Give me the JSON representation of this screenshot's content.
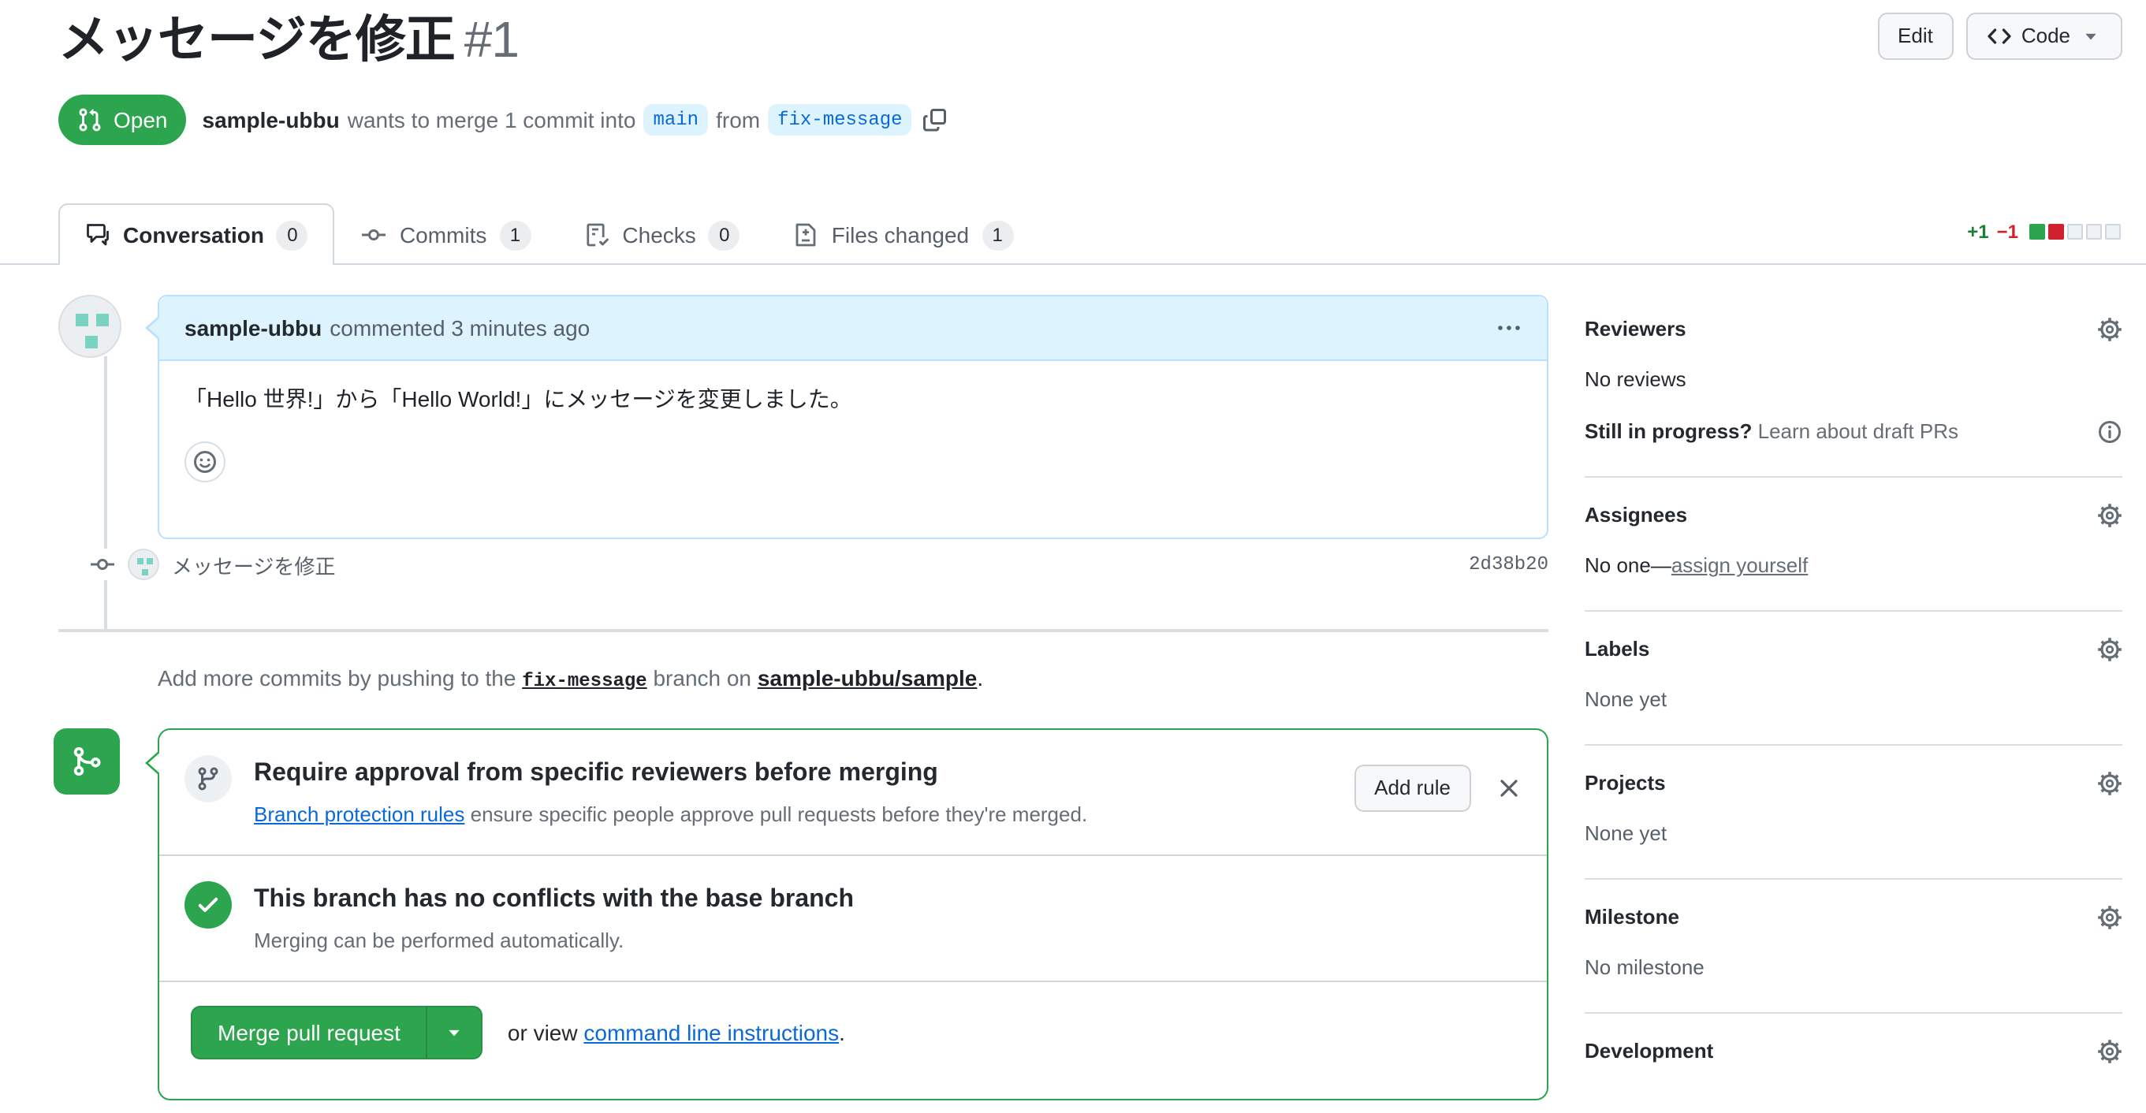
{
  "colors": {
    "open_green": "#2da44e",
    "link_blue": "#0969da",
    "added_green": "#1a7f37",
    "deleted_red": "#cf222e",
    "branch_label_bg": "#ddf4ff"
  },
  "header": {
    "title": "メッセージを修正",
    "number": "#1",
    "actions": {
      "edit": "Edit",
      "code": "Code"
    },
    "state": "Open",
    "meta": {
      "author": "sample-ubbu",
      "action": "wants to merge 1 commit into",
      "base_branch": "main",
      "from_word": "from",
      "head_branch": "fix-message"
    }
  },
  "tabs": [
    {
      "label": "Conversation",
      "count": "0"
    },
    {
      "label": "Commits",
      "count": "1"
    },
    {
      "label": "Checks",
      "count": "0"
    },
    {
      "label": "Files changed",
      "count": "1"
    }
  ],
  "diffstat": {
    "additions": "+1",
    "deletions": "−1"
  },
  "timeline": {
    "comment": {
      "author": "sample-ubbu",
      "meta": "commented 3 minutes ago",
      "body": "「Hello 世界!」から「Hello World!」にメッセージを変更しました。"
    },
    "commit": {
      "message": "メッセージを修正",
      "sha": "2d38b20"
    },
    "push_hint": {
      "prefix": "Add more commits by pushing to the",
      "branch": "fix-message",
      "middle": "branch on",
      "repo": "sample-ubbu/sample",
      "suffix": "."
    }
  },
  "merge_box": {
    "rule": {
      "title": "Require approval from specific reviewers before merging",
      "link": "Branch protection rules",
      "rest": "ensure specific people approve pull requests before they're merged.",
      "button": "Add rule"
    },
    "status": {
      "title": "This branch has no conflicts with the base branch",
      "subtitle": "Merging can be performed automatically."
    },
    "actions": {
      "merge": "Merge pull request",
      "or_view": "or view",
      "cli": "command line instructions",
      "period": "."
    }
  },
  "sidebar": {
    "reviewers": {
      "heading": "Reviewers",
      "empty": "No reviews",
      "draft_q": "Still in progress?",
      "draft_link": "Learn about draft PRs"
    },
    "assignees": {
      "heading": "Assignees",
      "empty": "No one—",
      "link": "assign yourself"
    },
    "labels": {
      "heading": "Labels",
      "empty": "None yet"
    },
    "projects": {
      "heading": "Projects",
      "empty": "None yet"
    },
    "milestone": {
      "heading": "Milestone",
      "empty": "No milestone"
    },
    "development": {
      "heading": "Development"
    }
  },
  "icons": {
    "git_pull_request": "pr-icon",
    "git_commit": "commit-icon",
    "git_branch": "branch-icon",
    "git_merge": "merge-icon",
    "comment": "conversation-icon",
    "checklist": "checks-icon",
    "file_diff": "files-changed-icon",
    "copy": "copy-icon",
    "kebab": "kebab-menu-icon",
    "smiley": "smiley-icon",
    "gear": "gear-icon",
    "info": "info-icon",
    "check": "check-icon",
    "x": "close-icon",
    "code": "code-icon",
    "triangle_down": "caret-down-icon"
  }
}
